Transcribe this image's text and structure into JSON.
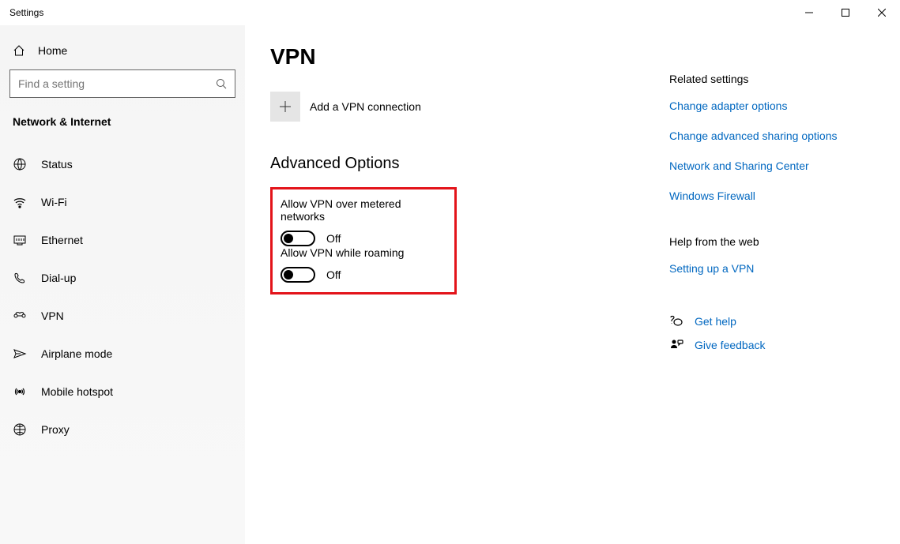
{
  "window": {
    "title": "Settings"
  },
  "sidebar": {
    "home": "Home",
    "searchPlaceholder": "Find a setting",
    "category": "Network & Internet",
    "items": [
      {
        "label": "Status",
        "icon": "status"
      },
      {
        "label": "Wi-Fi",
        "icon": "wifi"
      },
      {
        "label": "Ethernet",
        "icon": "ethernet"
      },
      {
        "label": "Dial-up",
        "icon": "dialup"
      },
      {
        "label": "VPN",
        "icon": "vpn"
      },
      {
        "label": "Airplane mode",
        "icon": "airplane"
      },
      {
        "label": "Mobile hotspot",
        "icon": "hotspot"
      },
      {
        "label": "Proxy",
        "icon": "proxy"
      }
    ]
  },
  "main": {
    "title": "VPN",
    "addLabel": "Add a VPN connection",
    "advanced": {
      "heading": "Advanced Options",
      "toggle1": {
        "label": "Allow VPN over metered networks",
        "state": "Off"
      },
      "toggle2": {
        "label": "Allow VPN while roaming",
        "state": "Off"
      }
    }
  },
  "related": {
    "heading": "Related settings",
    "links": [
      "Change adapter options",
      "Change advanced sharing options",
      "Network and Sharing Center",
      "Windows Firewall"
    ]
  },
  "help": {
    "heading": "Help from the web",
    "link": "Setting up a VPN"
  },
  "actions": {
    "getHelp": "Get help",
    "feedback": "Give feedback"
  }
}
